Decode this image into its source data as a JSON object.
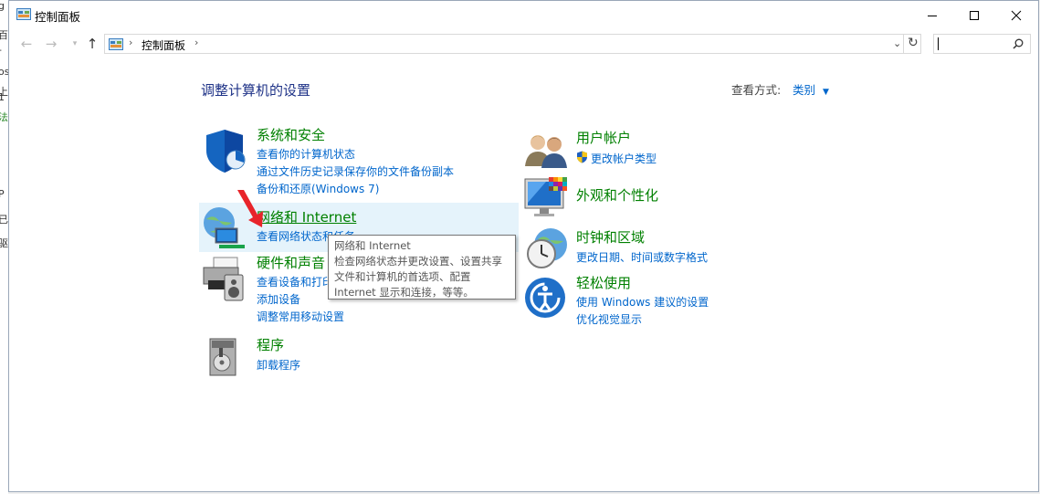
{
  "background_app": {
    "fragments": [
      "g",
      "百",
      "-",
      "os",
      "上",
      "1",
      "法",
      "P",
      "已",
      "驱"
    ]
  },
  "window": {
    "title": "控制面板",
    "controls": {
      "minimize": "—",
      "maximize": "☐",
      "close": "✕"
    }
  },
  "navigation": {
    "breadcrumb": "控制面板",
    "search": {
      "placeholder": ""
    }
  },
  "main": {
    "heading": "调整计算机的设置",
    "view_by_label": "查看方式:",
    "view_by_value": "类别"
  },
  "categories": {
    "system_security": {
      "title": "系统和安全",
      "links": [
        "查看你的计算机状态",
        "通过文件历史记录保存你的文件备份副本",
        "备份和还原(Windows 7)"
      ]
    },
    "network": {
      "title": "网络和 Internet",
      "links": [
        "查看网络状态和任务"
      ]
    },
    "hardware": {
      "title": "硬件和声音",
      "links": [
        "查看设备和打印机",
        "添加设备",
        "调整常用移动设置"
      ]
    },
    "programs": {
      "title": "程序",
      "links": [
        "卸载程序"
      ]
    },
    "user_accounts": {
      "title": "用户帐户",
      "links": [
        "更改帐户类型"
      ]
    },
    "appearance": {
      "title": "外观和个性化",
      "links": []
    },
    "clock_region": {
      "title": "时钟和区域",
      "links": [
        "更改日期、时间或数字格式"
      ]
    },
    "ease_of_access": {
      "title": "轻松使用",
      "links": [
        "使用 Windows 建议的设置",
        "优化视觉显示"
      ]
    }
  },
  "tooltip": {
    "lines": [
      "网络和 Internet",
      "检查网络状态并更改设置、设置共享",
      "文件和计算机的首选项、配置",
      "Internet 显示和连接，等等。"
    ]
  },
  "colors": {
    "category_title": "#008000",
    "link": "#0066cc",
    "heading": "#1e3287",
    "hover": "#e5f3fb",
    "annotation_arrow": "#e8242a"
  }
}
